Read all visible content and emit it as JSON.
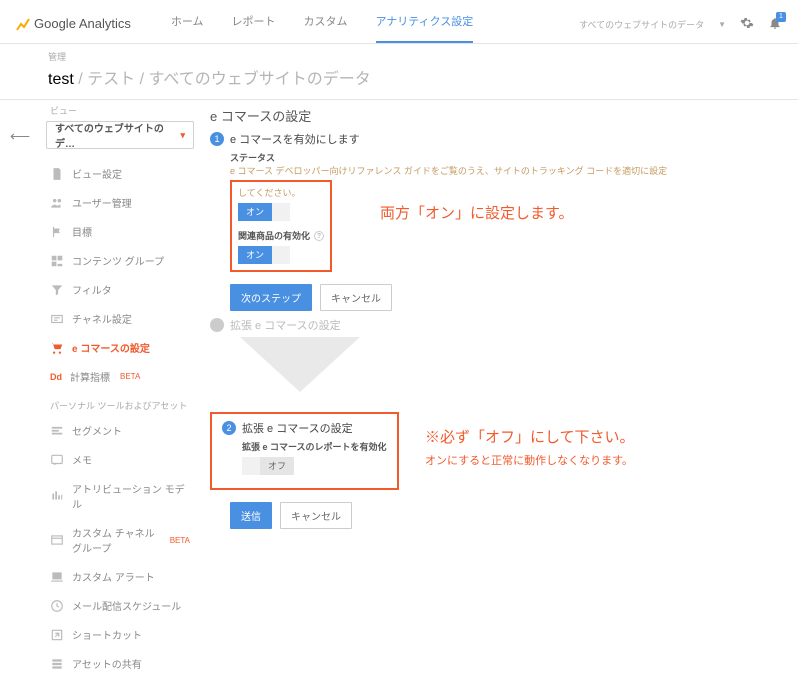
{
  "brand": "Google Analytics",
  "tabs": [
    "ホーム",
    "レポート",
    "カスタム",
    "アナリティクス設定"
  ],
  "active_tab": 3,
  "scope": "すべてのウェブサイトのデータ",
  "notif_count": "1",
  "bc": {
    "label": "管理",
    "strong": "test",
    "rest": " / テスト / すべてのウェブサイトのデータ"
  },
  "view": {
    "label": "ビュー",
    "selected": "すべてのウェブサイトのデ…"
  },
  "side1": [
    {
      "icon": "doc",
      "label": "ビュー設定"
    },
    {
      "icon": "users",
      "label": "ユーザー管理"
    },
    {
      "icon": "flag",
      "label": "目標"
    },
    {
      "icon": "content",
      "label": "コンテンツ グループ"
    },
    {
      "icon": "filter",
      "label": "フィルタ"
    },
    {
      "icon": "channel",
      "label": "チャネル設定"
    },
    {
      "icon": "cart",
      "label": "e コマースの設定",
      "active": true
    },
    {
      "icon": "dd",
      "label": "計算指標",
      "beta": "BETA"
    }
  ],
  "side_group": "パーソナル ツールおよびアセット",
  "side2": [
    {
      "icon": "segment",
      "label": "セグメント"
    },
    {
      "icon": "memo",
      "label": "メモ"
    },
    {
      "icon": "attrib",
      "label": "アトリビューション モデル"
    },
    {
      "icon": "cchannel",
      "label": "カスタム チャネル グループ",
      "beta": "BETA"
    },
    {
      "icon": "alert",
      "label": "カスタム アラート"
    },
    {
      "icon": "mail",
      "label": "メール配信スケジュール"
    },
    {
      "icon": "shortcut",
      "label": "ショートカット"
    },
    {
      "icon": "share",
      "label": "アセットの共有"
    }
  ],
  "page_title": "e コマースの設定",
  "step1": {
    "num": "1",
    "title": "e コマースを有効にします",
    "status_label": "ステータス",
    "help1": "e コマース デベロッパー向けリファレンス ガイドをご覧のうえ、サイトのトラッキング コードを適切に設定",
    "help2": "してください。",
    "related_label": "関連商品の有効化",
    "toggle_on": "オン",
    "next": "次のステップ",
    "cancel": "キャンセル"
  },
  "step2_grey": {
    "num": "",
    "title": "拡張 e コマースの設定"
  },
  "step2": {
    "num": "2",
    "title": "拡張 e コマースの設定",
    "sub": "拡張 e コマースのレポートを有効化",
    "toggle_off": "オフ",
    "send": "送信",
    "cancel": "キャンセル"
  },
  "annot1": "両方「オン」に設定します。",
  "annot2": "※必ず「オフ」にして下さい。",
  "annot3": "オンにすると正常に動作しなくなります。"
}
